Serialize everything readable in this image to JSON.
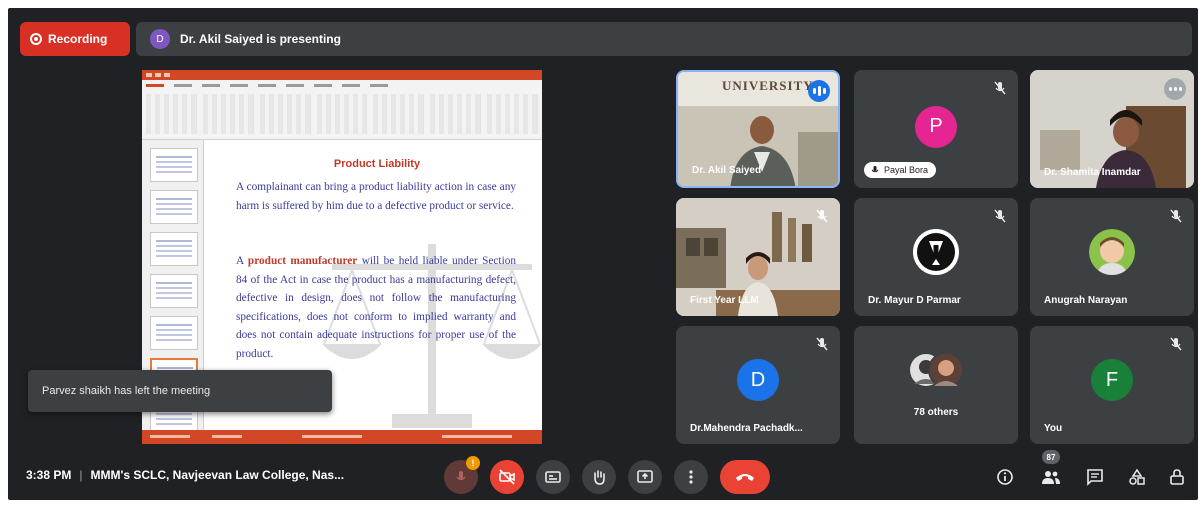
{
  "top_bar": {
    "recording_label": "Recording",
    "presenter_initial": "D",
    "presenting_text": "Dr. Akil Saiyed is presenting"
  },
  "slide": {
    "title": "Product Liability",
    "para1": "A complainant can bring a product liability action in case any harm is suffered by him due to a defective product or service.",
    "para2_prefix": "A ",
    "para2_highlight": "product manufacturer",
    "para2_suffix": " will be held liable under Section 84 of the Act in case the product has a manufacturing defect, defective in design, does not follow the manufacturing specifications, does not conform to implied warranty and does not contain adequate instructions for proper use of the product."
  },
  "participants": [
    {
      "name": "Dr. Akil Saiyed",
      "type": "video",
      "banner": "UNIVERSITY"
    },
    {
      "name": "Payal Bora",
      "type": "avatar",
      "initial": "P",
      "color": "#e52592"
    },
    {
      "name": "Dr. Shamita Inamdar",
      "type": "video"
    },
    {
      "name": "First Year LLM",
      "type": "video"
    },
    {
      "name": "Dr. Mayur D Parmar",
      "type": "avatar-img"
    },
    {
      "name": "Anugrah Narayan",
      "type": "avatar-img"
    },
    {
      "name": "Dr.Mahendra Pachadk...",
      "type": "avatar",
      "initial": "D",
      "color": "#1a73e8"
    },
    {
      "name": "78 others",
      "type": "group"
    },
    {
      "name": "You",
      "type": "avatar",
      "initial": "F",
      "color": "#188038"
    }
  ],
  "toast": {
    "text": "Parvez shaikh has left the meeting"
  },
  "bottom_bar": {
    "time": "3:38 PM",
    "separator": "|",
    "meeting_title": "MMM's SCLC, Navjeevan Law College, Nas...",
    "mic_badge": "!",
    "participants_count": "87"
  },
  "icons": {
    "record": "record-icon",
    "mic": "mic-off-icon",
    "camera": "camera-off-icon",
    "captions": "captions-icon",
    "hand": "raise-hand-icon",
    "present": "present-icon",
    "more": "more-vert-icon",
    "hangup": "call-end-icon",
    "info": "info-icon",
    "people": "people-icon",
    "chat": "chat-icon",
    "activities": "activities-icon",
    "lock": "host-controls-icon"
  },
  "colors": {
    "background": "#202124",
    "tile": "#3c4043",
    "red": "#ea4335",
    "recording": "#d93025",
    "speaking": "#1a73e8"
  }
}
